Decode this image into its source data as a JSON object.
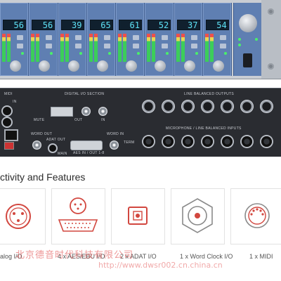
{
  "front_panel": {
    "channel_readouts": [
      "56",
      "56",
      "39",
      "65",
      "61",
      "52",
      "37",
      "54"
    ]
  },
  "rear_panel": {
    "labels": {
      "midi": "MIDI",
      "digital": "DIGITAL I/O SECTION",
      "line_outputs": "LINE BALANCED OUTPUTS",
      "line_inputs": "MICROPHONE / LINE BALANCED INPUTS",
      "word_out": "WORD OUT",
      "word_in": "WORD IN",
      "word_term": "TERM",
      "adat_out": "ADAT OUT",
      "aes_io": "AES IN / OUT 1-8",
      "in": "IN",
      "out": "OUT",
      "mute": "MUTE",
      "main": "MAIN"
    }
  },
  "connectivity": {
    "heading": "ctivity and Features",
    "items": [
      {
        "label": "alog I/O",
        "icon": "xlr-connector-icon"
      },
      {
        "label": "4 x AES/EBU I/O",
        "icon": "xlr-dsub-connector-icon"
      },
      {
        "label": "2 x ADAT I/O",
        "icon": "optical-port-icon"
      },
      {
        "label": "1 x Word Clock I/O",
        "icon": "bnc-connector-icon"
      },
      {
        "label": "1 x MIDI",
        "icon": "midi-din-icon"
      }
    ]
  },
  "watermark": {
    "company": "北京德音时代科技有限公司",
    "url": "http://www.dwsr002.cn.china.cn"
  },
  "colors": {
    "panel_blue": "#5f7fb2",
    "lcd_text": "#5de2f5",
    "icon_red": "#d2473f",
    "watermark": "#e04040"
  }
}
